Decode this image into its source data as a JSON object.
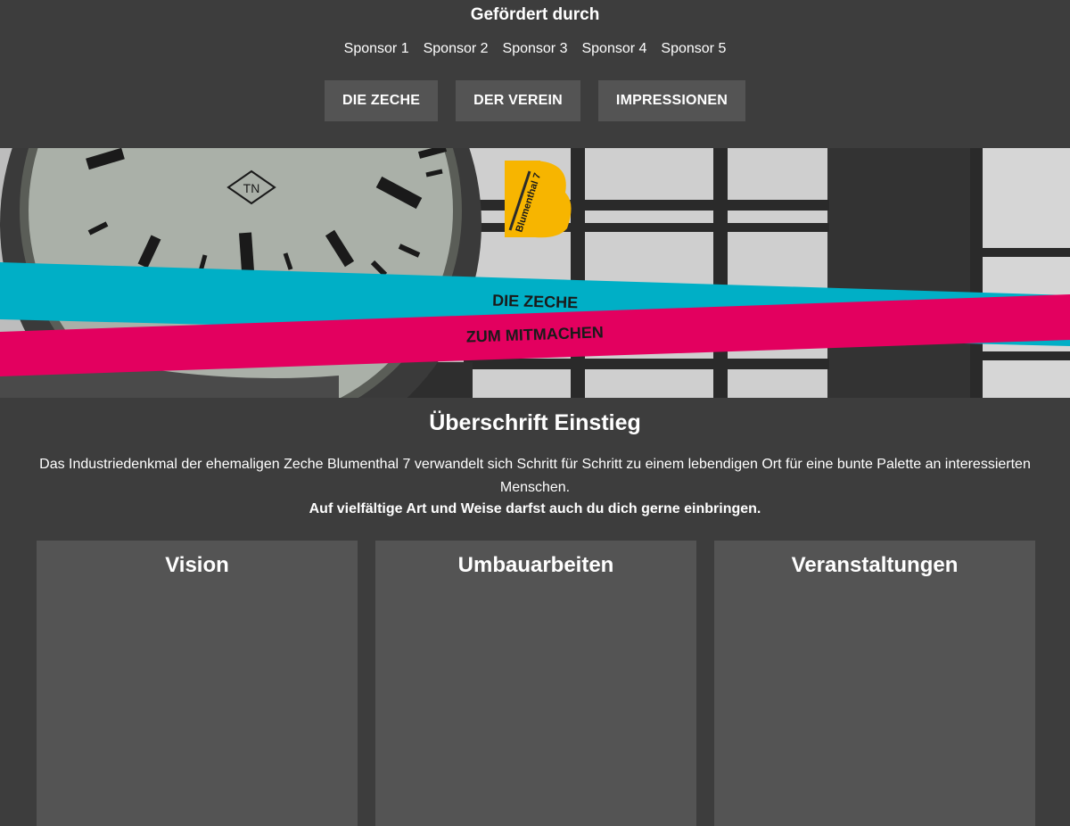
{
  "sponsors": {
    "title": "Gefördert durch",
    "items": [
      "Sponsor 1",
      "Sponsor 2",
      "Sponsor 3",
      "Sponsor 4",
      "Sponsor 5"
    ]
  },
  "nav": {
    "items": [
      "DIE ZECHE",
      "DER VEREIN",
      "IMPRESSIONEN"
    ]
  },
  "hero": {
    "logo_letter": "B",
    "logo_text": "Blumenthal 7",
    "clock_brand": "TN",
    "banner_cyan": "DIE ZECHE",
    "banner_magenta": "ZUM MITMACHEN",
    "colors": {
      "cyan": "#00afc6",
      "magenta": "#e3005f",
      "logo": "#f7b500"
    }
  },
  "intro": {
    "title": "Überschrift Einstieg",
    "text": "Das Industriedenkmal der ehemaligen Zeche Blumenthal 7 verwandelt sich Schritt für Schritt zu einem lebendigen Ort für eine bunte Palette an interessierten Menschen.",
    "bold": "Auf vielfältige Art und Weise darfst auch du dich gerne einbringen."
  },
  "cards": [
    {
      "title": "Vision"
    },
    {
      "title": "Umbauarbeiten"
    },
    {
      "title": "Veranstaltungen"
    }
  ]
}
